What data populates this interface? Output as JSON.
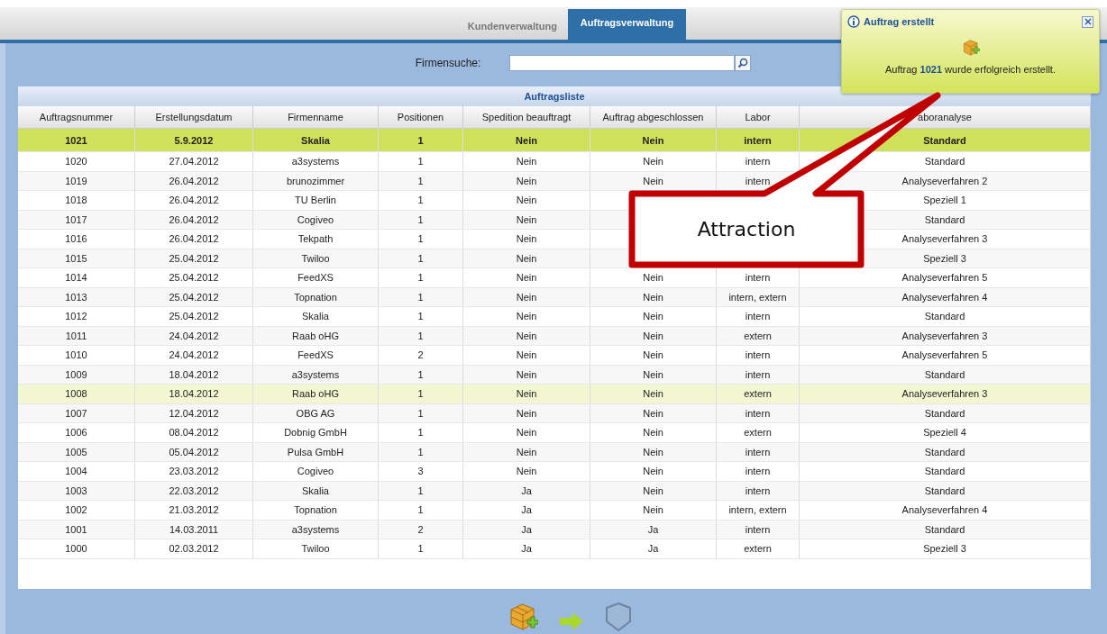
{
  "tabs": [
    {
      "label": "Kundenverwaltung",
      "selected": false
    },
    {
      "label": "Auftragsverwaltung",
      "selected": true
    }
  ],
  "search": {
    "label": "Firmensuche:"
  },
  "table": {
    "title": "Auftragsliste",
    "columns": [
      "Auftragsnummer",
      "Erstellungsdatum",
      "Firmenname",
      "Positionen",
      "Spedition beauftragt",
      "Auftrag abgeschlossen",
      "Labor",
      "aboranalyse"
    ],
    "rows": [
      {
        "new": true,
        "selected": false,
        "cells": [
          "1021",
          "5.9.2012",
          "Skalia",
          "1",
          "Nein",
          "Nein",
          "intern",
          "Standard"
        ]
      },
      {
        "new": false,
        "selected": false,
        "cells": [
          "1020",
          "27.04.2012",
          "a3systems",
          "1",
          "Nein",
          "Nein",
          "intern",
          "Standard"
        ]
      },
      {
        "new": false,
        "selected": false,
        "cells": [
          "1019",
          "26.04.2012",
          "brunozimmer",
          "1",
          "Nein",
          "Nein",
          "intern",
          "Analyseverfahren 2"
        ]
      },
      {
        "new": false,
        "selected": false,
        "cells": [
          "1018",
          "26.04.2012",
          "TU Berlin",
          "1",
          "Nein",
          null,
          null,
          "Speziell 1"
        ]
      },
      {
        "new": false,
        "selected": false,
        "cells": [
          "1017",
          "26.04.2012",
          "Cogiveo",
          "1",
          "Nein",
          null,
          null,
          "Standard"
        ]
      },
      {
        "new": false,
        "selected": false,
        "cells": [
          "1016",
          "26.04.2012",
          "Tekpath",
          "1",
          "Nein",
          null,
          null,
          "Analyseverfahren 3"
        ]
      },
      {
        "new": false,
        "selected": false,
        "cells": [
          "1015",
          "25.04.2012",
          "Twiloo",
          "1",
          "Nein",
          null,
          null,
          "Speziell 3"
        ]
      },
      {
        "new": false,
        "selected": false,
        "cells": [
          "1014",
          "25.04.2012",
          "FeedXS",
          "1",
          "Nein",
          "Nein",
          "intern",
          "Analyseverfahren 5"
        ]
      },
      {
        "new": false,
        "selected": false,
        "cells": [
          "1013",
          "25.04.2012",
          "Topnation",
          "1",
          "Nein",
          "Nein",
          "intern, extern",
          "Analyseverfahren 4"
        ]
      },
      {
        "new": false,
        "selected": false,
        "cells": [
          "1012",
          "25.04.2012",
          "Skalia",
          "1",
          "Nein",
          "Nein",
          "intern",
          "Standard"
        ]
      },
      {
        "new": false,
        "selected": false,
        "cells": [
          "1011",
          "24.04.2012",
          "Raab oHG",
          "1",
          "Nein",
          "Nein",
          "extern",
          "Analyseverfahren 3"
        ]
      },
      {
        "new": false,
        "selected": false,
        "cells": [
          "1010",
          "24.04.2012",
          "FeedXS",
          "2",
          "Nein",
          "Nein",
          "intern",
          "Analyseverfahren 5"
        ]
      },
      {
        "new": false,
        "selected": false,
        "cells": [
          "1009",
          "18.04.2012",
          "a3systems",
          "1",
          "Nein",
          "Nein",
          "intern",
          "Standard"
        ]
      },
      {
        "new": false,
        "selected": true,
        "cells": [
          "1008",
          "18.04.2012",
          "Raab oHG",
          "1",
          "Nein",
          "Nein",
          "extern",
          "Analyseverfahren 3"
        ]
      },
      {
        "new": false,
        "selected": false,
        "cells": [
          "1007",
          "12.04.2012",
          "OBG AG",
          "1",
          "Nein",
          "Nein",
          "intern",
          "Standard"
        ]
      },
      {
        "new": false,
        "selected": false,
        "cells": [
          "1006",
          "08.04.2012",
          "Dobnig GmbH",
          "1",
          "Nein",
          "Nein",
          "extern",
          "Speziell 4"
        ]
      },
      {
        "new": false,
        "selected": false,
        "cells": [
          "1005",
          "05.04.2012",
          "Pulsa GmbH",
          "1",
          "Nein",
          "Nein",
          "intern",
          "Standard"
        ]
      },
      {
        "new": false,
        "selected": false,
        "cells": [
          "1004",
          "23.03.2012",
          "Cogiveo",
          "3",
          "Nein",
          "Nein",
          "intern",
          "Standard"
        ]
      },
      {
        "new": false,
        "selected": false,
        "cells": [
          "1003",
          "22.03.2012",
          "Skalia",
          "1",
          "Ja",
          "Nein",
          "intern",
          "Standard"
        ]
      },
      {
        "new": false,
        "selected": false,
        "cells": [
          "1002",
          "21.03.2012",
          "Topnation",
          "1",
          "Ja",
          "Nein",
          "intern, extern",
          "Analyseverfahren 4"
        ]
      },
      {
        "new": false,
        "selected": false,
        "cells": [
          "1001",
          "14.03.2011",
          "a3systems",
          "2",
          "Ja",
          "Ja",
          "intern",
          "Standard"
        ]
      },
      {
        "new": false,
        "selected": false,
        "cells": [
          "1000",
          "02.03.2012",
          "Twiloo",
          "1",
          "Ja",
          "Ja",
          "extern",
          "Speziell 3"
        ]
      }
    ]
  },
  "notification": {
    "title": "Auftrag erstellt",
    "message": "Auftrag **1021** wurde erfolgreich erstellt."
  },
  "callout": {
    "label": "Attraction"
  }
}
